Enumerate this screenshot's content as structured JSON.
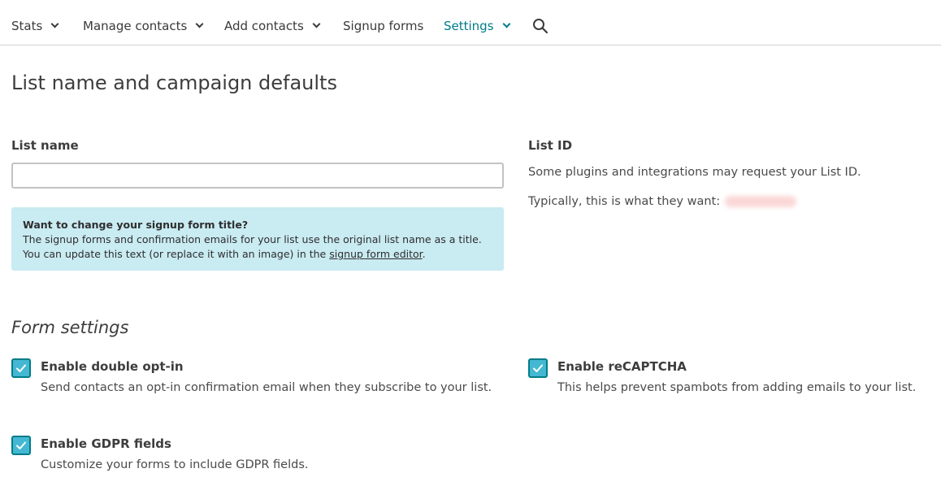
{
  "nav": {
    "items": [
      {
        "label": "Stats",
        "dropdown": true
      },
      {
        "label": "Manage contacts",
        "dropdown": true
      },
      {
        "label": "Add contacts",
        "dropdown": true
      },
      {
        "label": "Signup forms",
        "dropdown": false
      },
      {
        "label": "Settings",
        "dropdown": true,
        "active": true
      }
    ],
    "search_icon": "search-icon"
  },
  "page": {
    "title": "List name and campaign defaults"
  },
  "list_name": {
    "label": "List name",
    "value": ""
  },
  "info_box": {
    "title": "Want to change your signup form title?",
    "body": "The signup forms and confirmation emails for your list use the original list name as a title. You can update this text (or replace it with an image) in the",
    "link": "signup form editor",
    "after_link": ".",
    "background": "#c9ebf2"
  },
  "list_id": {
    "label": "List ID",
    "description": "Some plugins and integrations may request your List ID.",
    "typical_text": "Typically, this is what they want:"
  },
  "form_settings": {
    "heading": "Form settings",
    "options": [
      {
        "label": "Enable double opt-in",
        "description": "Send contacts an opt-in confirmation email when they subscribe to your list.",
        "checked": true
      },
      {
        "label": "Enable reCAPTCHA",
        "description": "This helps prevent spambots from adding emails to your list.",
        "checked": true
      },
      {
        "label": "Enable GDPR fields",
        "description": "Customize your forms to include GDPR fields.",
        "checked": true
      }
    ]
  },
  "colors": {
    "accent": "#007c89",
    "checkbox_fill": "#44b8d3"
  }
}
